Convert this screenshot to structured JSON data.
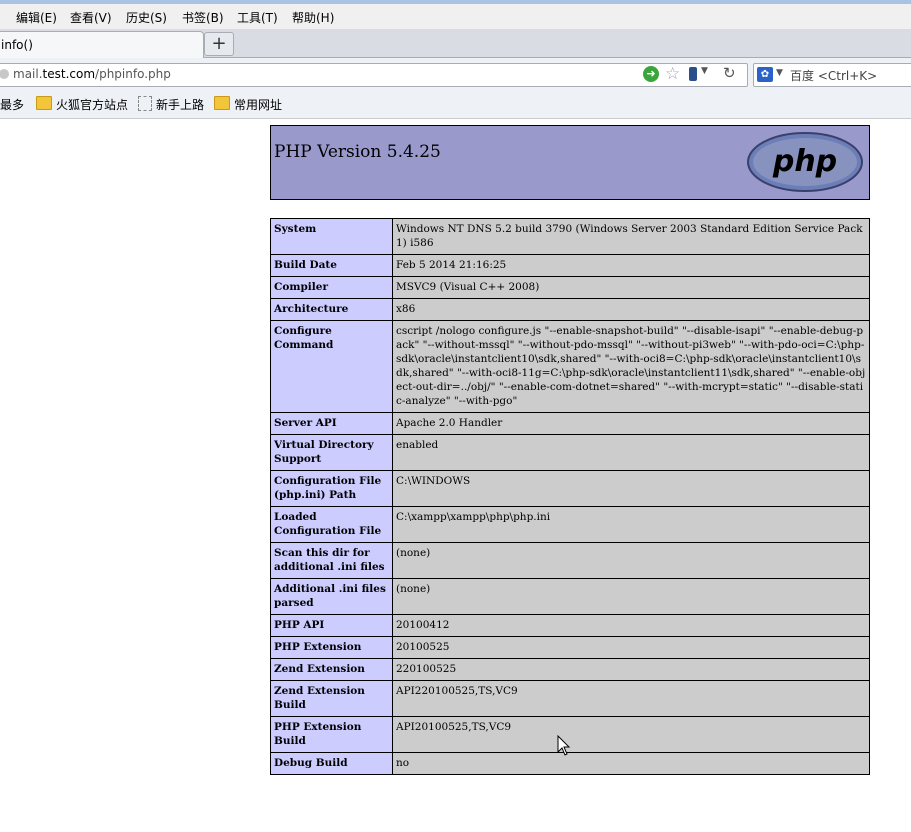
{
  "menu": [
    "编辑(E)",
    "查看(V)",
    "历史(S)",
    "书签(B)",
    "工具(T)",
    "帮助(H)"
  ],
  "tab": {
    "title": "info()",
    "new_tab": "+"
  },
  "url": {
    "prefix": "mail.",
    "domain": "test.com",
    "path": "/phpinfo.php"
  },
  "search": {
    "placeholder": "百度 <Ctrl+K>"
  },
  "bookmarks": [
    "最多",
    "火狐官方站点",
    "新手上路",
    "常用网址"
  ],
  "phpinfo": {
    "header": "PHP Version 5.4.25",
    "logo_text": "php",
    "rows": [
      {
        "key": "System",
        "value": "Windows NT DNS 5.2 build 3790 (Windows Server 2003 Standard Edition Service Pack 1) i586"
      },
      {
        "key": "Build Date",
        "value": "Feb 5 2014 21:16:25"
      },
      {
        "key": "Compiler",
        "value": "MSVC9 (Visual C++ 2008)"
      },
      {
        "key": "Architecture",
        "value": "x86"
      },
      {
        "key": "Configure Command",
        "value": "cscript /nologo configure.js \"--enable-snapshot-build\" \"--disable-isapi\" \"--enable-debug-pack\" \"--without-mssql\" \"--without-pdo-mssql\" \"--without-pi3web\" \"--with-pdo-oci=C:\\php-sdk\\oracle\\instantclient10\\sdk,shared\" \"--with-oci8=C:\\php-sdk\\oracle\\instantclient10\\sdk,shared\" \"--with-oci8-11g=C:\\php-sdk\\oracle\\instantclient11\\sdk,shared\" \"--enable-object-out-dir=../obj/\" \"--enable-com-dotnet=shared\" \"--with-mcrypt=static\" \"--disable-static-analyze\" \"--with-pgo\""
      },
      {
        "key": "Server API",
        "value": "Apache 2.0 Handler"
      },
      {
        "key": "Virtual Directory Support",
        "value": "enabled"
      },
      {
        "key": "Configuration File (php.ini) Path",
        "value": "C:\\WINDOWS"
      },
      {
        "key": "Loaded Configuration File",
        "value": "C:\\xampp\\xampp\\php\\php.ini"
      },
      {
        "key": "Scan this dir for additional .ini files",
        "value": "(none)"
      },
      {
        "key": "Additional .ini files parsed",
        "value": "(none)"
      },
      {
        "key": "PHP API",
        "value": "20100412"
      },
      {
        "key": "PHP Extension",
        "value": "20100525"
      },
      {
        "key": "Zend Extension",
        "value": "220100525"
      },
      {
        "key": "Zend Extension Build",
        "value": "API220100525,TS,VC9"
      },
      {
        "key": "PHP Extension Build",
        "value": "API20100525,TS,VC9"
      },
      {
        "key": "Debug Build",
        "value": "no"
      }
    ]
  }
}
